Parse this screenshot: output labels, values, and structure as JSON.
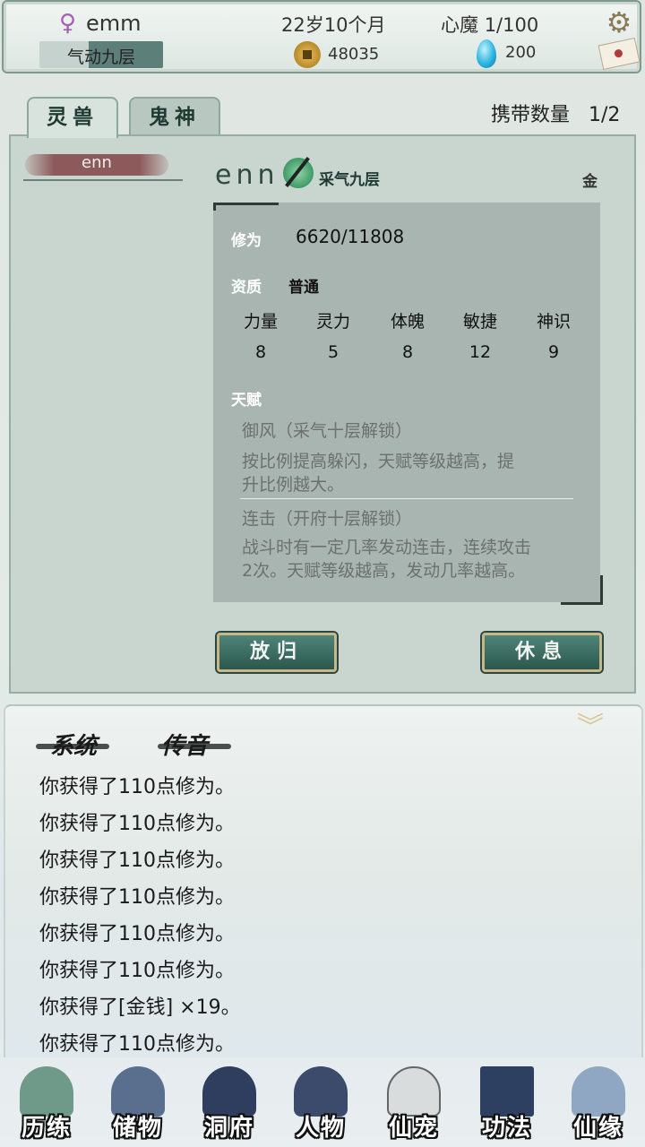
{
  "header": {
    "gender_icon": "female-icon",
    "player_name": "emm",
    "realm": "气动九层",
    "age": "22岁10个月",
    "xinmo_label": "心魔",
    "xinmo_value": "1/100",
    "coins": "48035",
    "gems": "200",
    "gear_icon": "gear-icon",
    "mail_icon": "mail-icon"
  },
  "tabs": [
    {
      "label": "灵兽",
      "active": true
    },
    {
      "label": "鬼神",
      "active": false
    }
  ],
  "carry": {
    "label": "携带数量",
    "value": "1/2"
  },
  "pet": {
    "list_name": "enn",
    "name": "enn",
    "realm": "采气九层",
    "element": "金",
    "cultivation_label": "修为",
    "cultivation_value": "6620/11808",
    "aptitude_label": "资质",
    "aptitude_value": "普通",
    "stats": [
      {
        "name": "力量",
        "value": "8"
      },
      {
        "name": "灵力",
        "value": "5"
      },
      {
        "name": "体魄",
        "value": "8"
      },
      {
        "name": "敏捷",
        "value": "12"
      },
      {
        "name": "神识",
        "value": "9"
      }
    ],
    "talent_label": "天赋",
    "talents": [
      {
        "title": "御风（采气十层解锁）",
        "desc": "按比例提高躲闪，天赋等级越高，提升比例越大。"
      },
      {
        "title": "连击（开府十层解锁）",
        "desc": "战斗时有一定几率发动连击，连续攻击2次。天赋等级越高，发动几率越高。"
      }
    ]
  },
  "buttons": {
    "release": "放归",
    "rest": "休息"
  },
  "log": {
    "tabs": [
      "系统",
      "传音"
    ],
    "messages": [
      "你获得了110点修为。",
      "你获得了110点修为。",
      "你获得了110点修为。",
      "你获得了110点修为。",
      "你获得了110点修为。",
      "你获得了110点修为。",
      "你获得了[金钱] ×19。",
      "你获得了110点修为。"
    ]
  },
  "nav": [
    {
      "label": "历练",
      "icon": "mountain-icon",
      "color": "#6f9a8a"
    },
    {
      "label": "储物",
      "icon": "gourd-icon",
      "color": "#5a6f8e"
    },
    {
      "label": "洞府",
      "icon": "pagoda-icon",
      "color": "#2f3d5e"
    },
    {
      "label": "人物",
      "icon": "person-icon",
      "color": "#3c4a6c"
    },
    {
      "label": "仙宠",
      "icon": "ghost-pet-icon",
      "color": "#d8dcdc"
    },
    {
      "label": "功法",
      "icon": "book-icon",
      "color": "#2e4062"
    },
    {
      "label": "仙缘",
      "icon": "crane-icon",
      "color": "#8fa7c2"
    }
  ]
}
